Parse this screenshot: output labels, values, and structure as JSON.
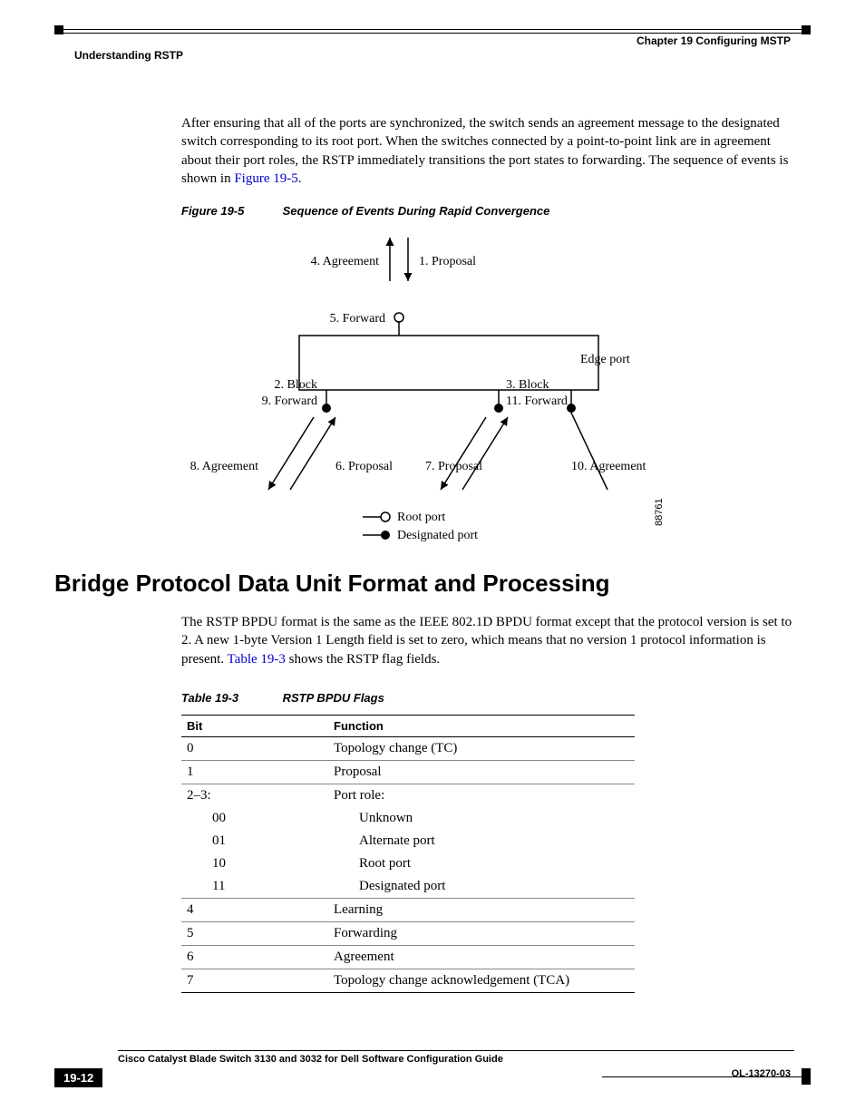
{
  "header": {
    "chapter": "Chapter 19    Configuring MSTP",
    "section": "Understanding RSTP"
  },
  "para1_a": "After ensuring that all of the ports are synchronized, the switch sends an agreement message to the designated switch corresponding to its root port. When the switches connected by a point-to-point link are in agreement about their port roles, the RSTP immediately transitions the port states to forwarding. The sequence of events is shown in ",
  "para1_link": "Figure 19-5",
  "para1_b": ".",
  "figure": {
    "num": "Figure 19-5",
    "title": "Sequence of Events During Rapid Convergence",
    "labels": {
      "l4": "4. Agreement",
      "l1": "1. Proposal",
      "l5": "5. Forward",
      "edge": "Edge port",
      "l2": "2. Block",
      "l9": "9. Forward",
      "l3": "3. Block",
      "l11": "11. Forward",
      "l8": "8. Agreement",
      "l6": "6. Proposal",
      "l7": "7. Proposal",
      "l10": "10. Agreement",
      "root": "Root port",
      "desig": "Designated port",
      "id": "88761"
    }
  },
  "h2": "Bridge Protocol Data Unit Format and Processing",
  "para2_a": "The RSTP BPDU format is the same as the IEEE 802.1D BPDU format except that the protocol version is set to 2. A new 1-byte Version 1 Length field is set to zero, which means that no version 1 protocol information is present. ",
  "para2_link": "Table 19-3",
  "para2_b": " shows the RSTP flag fields.",
  "table": {
    "num": "Table 19-3",
    "title": "RSTP BPDU Flags",
    "headers": {
      "bit": "Bit",
      "func": "Function"
    },
    "rows": [
      {
        "bit": "0",
        "func": "Topology change (TC)",
        "sep": true
      },
      {
        "bit": "1",
        "func": "Proposal",
        "sep": true
      },
      {
        "bit": "2–3:",
        "func": "Port role:",
        "sep": true
      },
      {
        "bit": "00",
        "func": "Unknown",
        "sub": true
      },
      {
        "bit": "01",
        "func": "Alternate port",
        "sub": true
      },
      {
        "bit": "10",
        "func": "Root port",
        "sub": true
      },
      {
        "bit": "11",
        "func": "Designated port",
        "sub": true
      },
      {
        "bit": "4",
        "func": "Learning",
        "sep": true
      },
      {
        "bit": "5",
        "func": "Forwarding",
        "sep": true
      },
      {
        "bit": "6",
        "func": "Agreement",
        "sep": true
      },
      {
        "bit": "7",
        "func": "Topology change acknowledgement (TCA)",
        "sep": true,
        "last": true
      }
    ]
  },
  "footer": {
    "title": "Cisco Catalyst Blade Switch 3130 and 3032 for Dell Software Configuration Guide",
    "page": "19-12",
    "docid": "OL-13270-03"
  }
}
